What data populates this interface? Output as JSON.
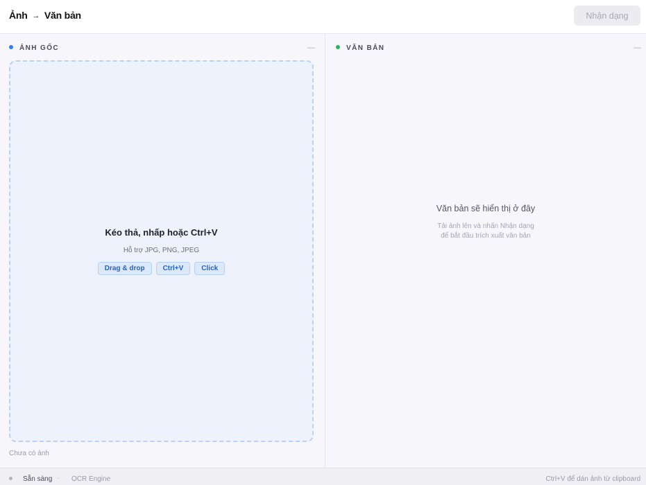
{
  "header": {
    "title_left": "Ảnh",
    "title_arrow": "→",
    "title_right": "Văn bản",
    "recognize_label": "Nhận dạng"
  },
  "source_panel": {
    "heading": "ẢNH GỐC",
    "collapse_glyph": "—",
    "dropzone": {
      "title": "Kéo thả, nhấp hoặc Ctrl+V",
      "subtitle": "Hỗ trợ JPG, PNG, JPEG",
      "chips": [
        "Drag & drop",
        "Ctrl+V",
        "Click"
      ]
    },
    "status": "Chưa có ảnh"
  },
  "text_panel": {
    "heading": "VĂN BẢN",
    "collapse_glyph": "—",
    "empty_title": "Văn bản sẽ hiển thị ở đây",
    "empty_hint_line1": "Tải ảnh lên và nhấn Nhận dạng",
    "empty_hint_line2": "để bắt đầu trích xuất văn bản"
  },
  "statusbar": {
    "state": "Sẵn sàng",
    "separator": "·",
    "engine": "OCR Engine",
    "hint": "Ctrl+V để dán ảnh từ clipboard"
  },
  "colors": {
    "accent_blue": "#2f7df6",
    "accent_green": "#2ab35a",
    "dropzone_bg": "#edf2fc",
    "dropzone_border": "#b8d2f4"
  }
}
